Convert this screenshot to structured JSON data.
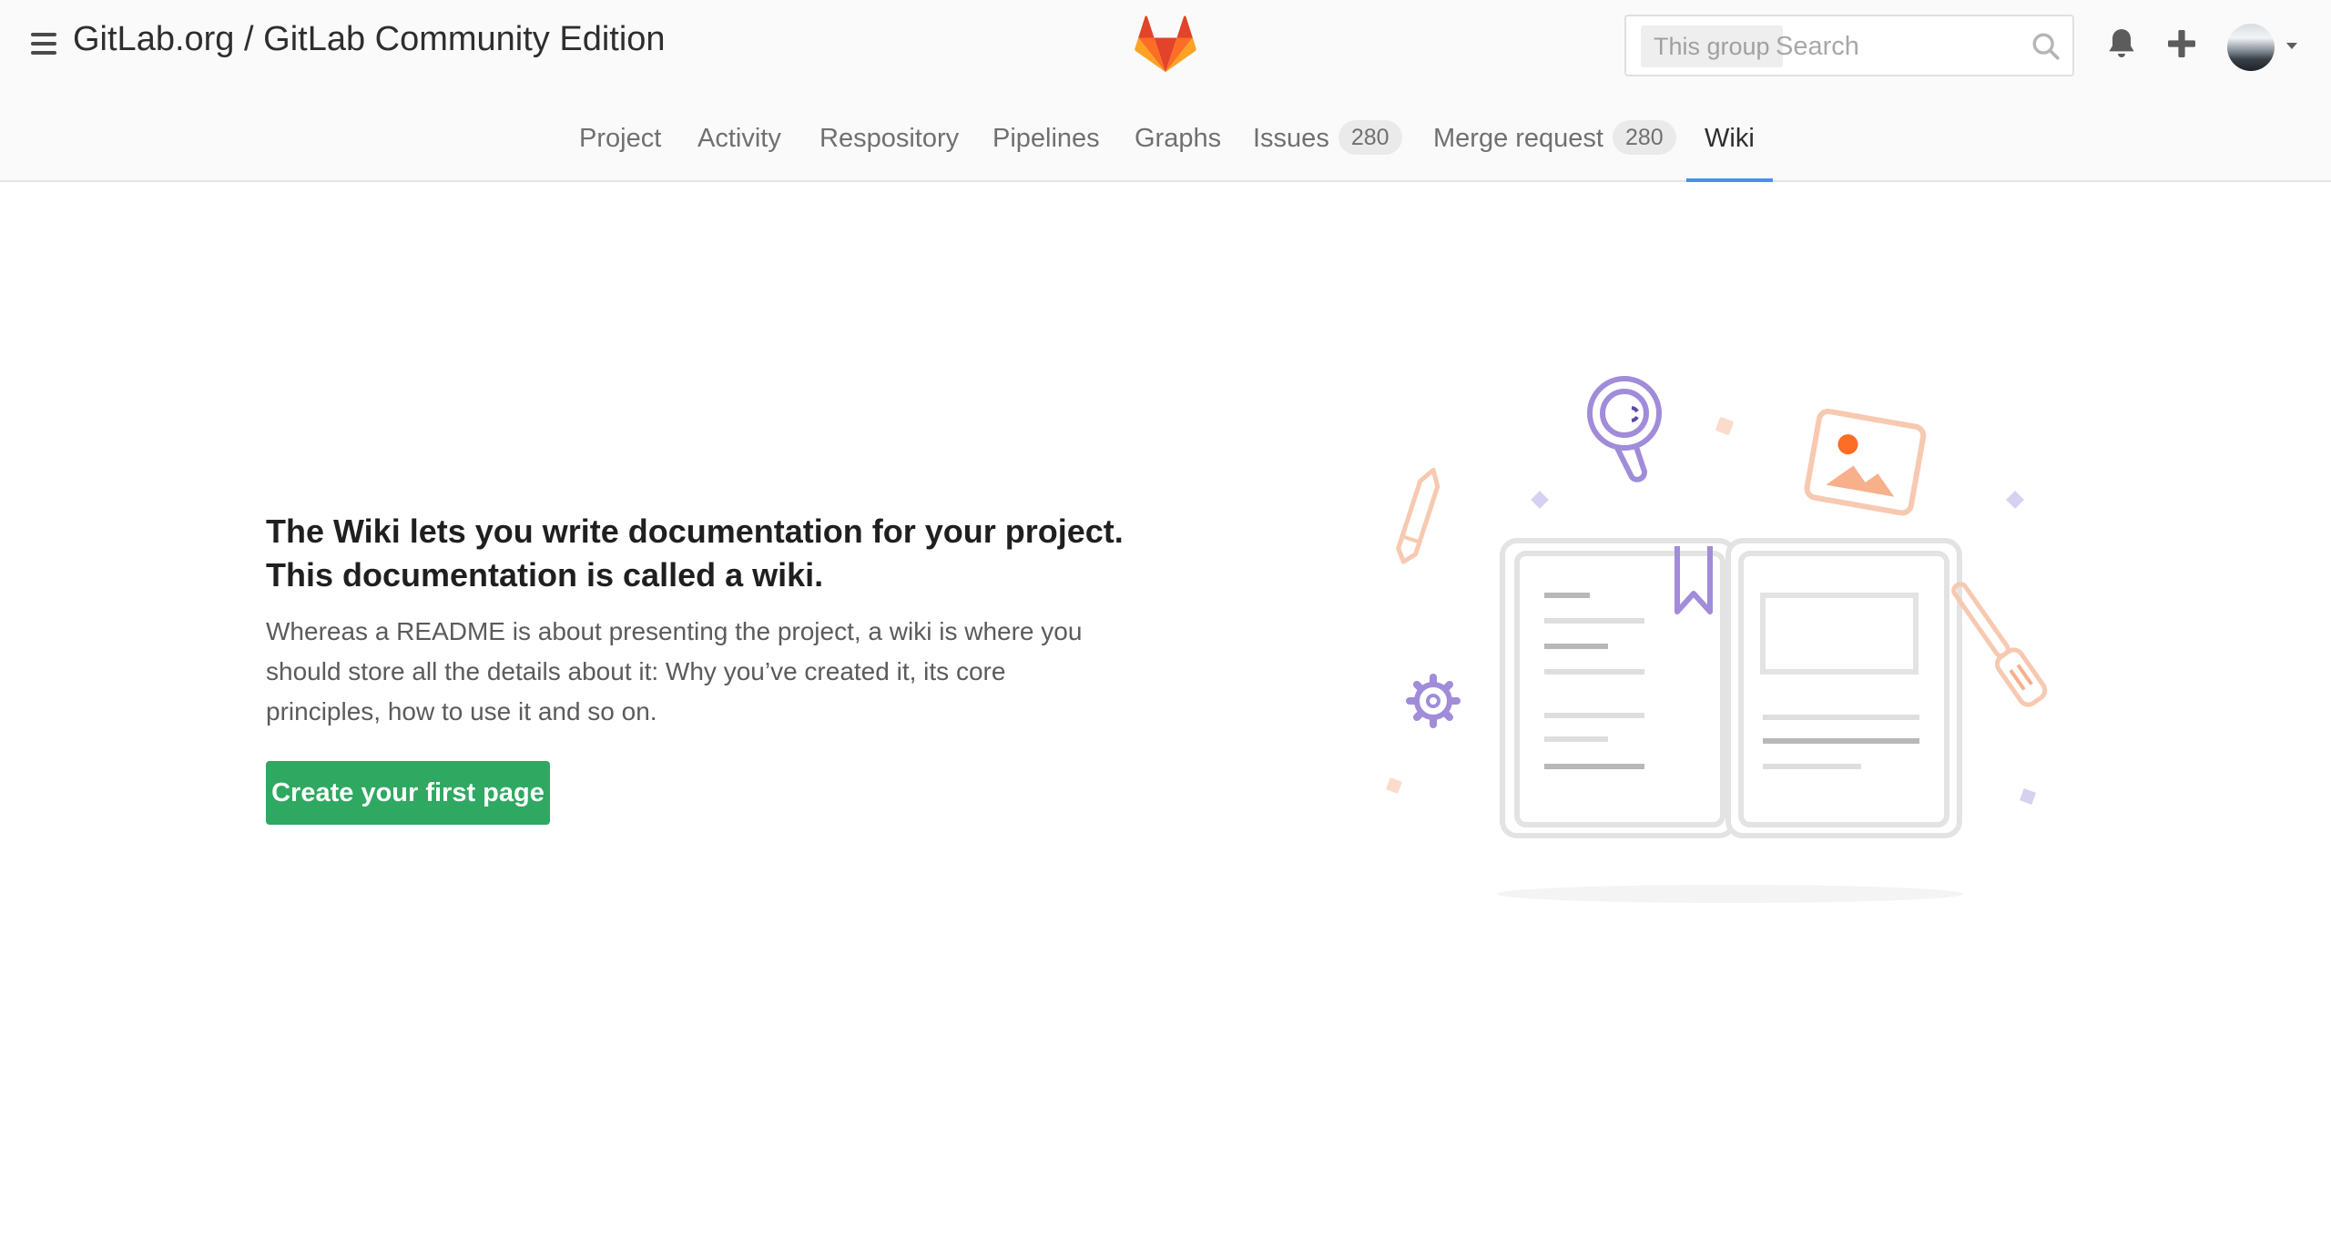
{
  "header": {
    "breadcrumb_group": "GitLab.org",
    "breadcrumb_separator": " / ",
    "breadcrumb_project": "GitLab Community Edition",
    "search_scope": "This group",
    "search_placeholder": "Search"
  },
  "nav": {
    "items": [
      {
        "label": "Project"
      },
      {
        "label": "Activity"
      },
      {
        "label": "Respository"
      },
      {
        "label": "Pipelines"
      },
      {
        "label": "Graphs"
      },
      {
        "label": "Issues",
        "count": "280"
      },
      {
        "label": "Merge request",
        "count": "280"
      },
      {
        "label": "Wiki",
        "active": true
      }
    ]
  },
  "empty_state": {
    "heading_line1": "The Wiki lets you write documentation for your project.",
    "heading_line2": "This documentation is called a wiki.",
    "description": "Whereas a README is about presenting the project, a wiki is where you should store all the details about it: Why you’ve created it, its core principles, how to use it and so on.",
    "button_label": "Create your first page"
  },
  "icons": [
    "hamburger-icon",
    "gitlab-logo-icon",
    "search-icon",
    "bell-icon",
    "plus-icon",
    "avatar",
    "chevron-down-icon"
  ],
  "colors": {
    "accent": "#4a8ff0",
    "button": "#2fa861",
    "logo_orange": "#fc6d26",
    "logo_red": "#e24329",
    "logo_yellow": "#fca326",
    "illustration_purple": "#a08cd9",
    "illustration_peach": "#f7c9b0"
  }
}
